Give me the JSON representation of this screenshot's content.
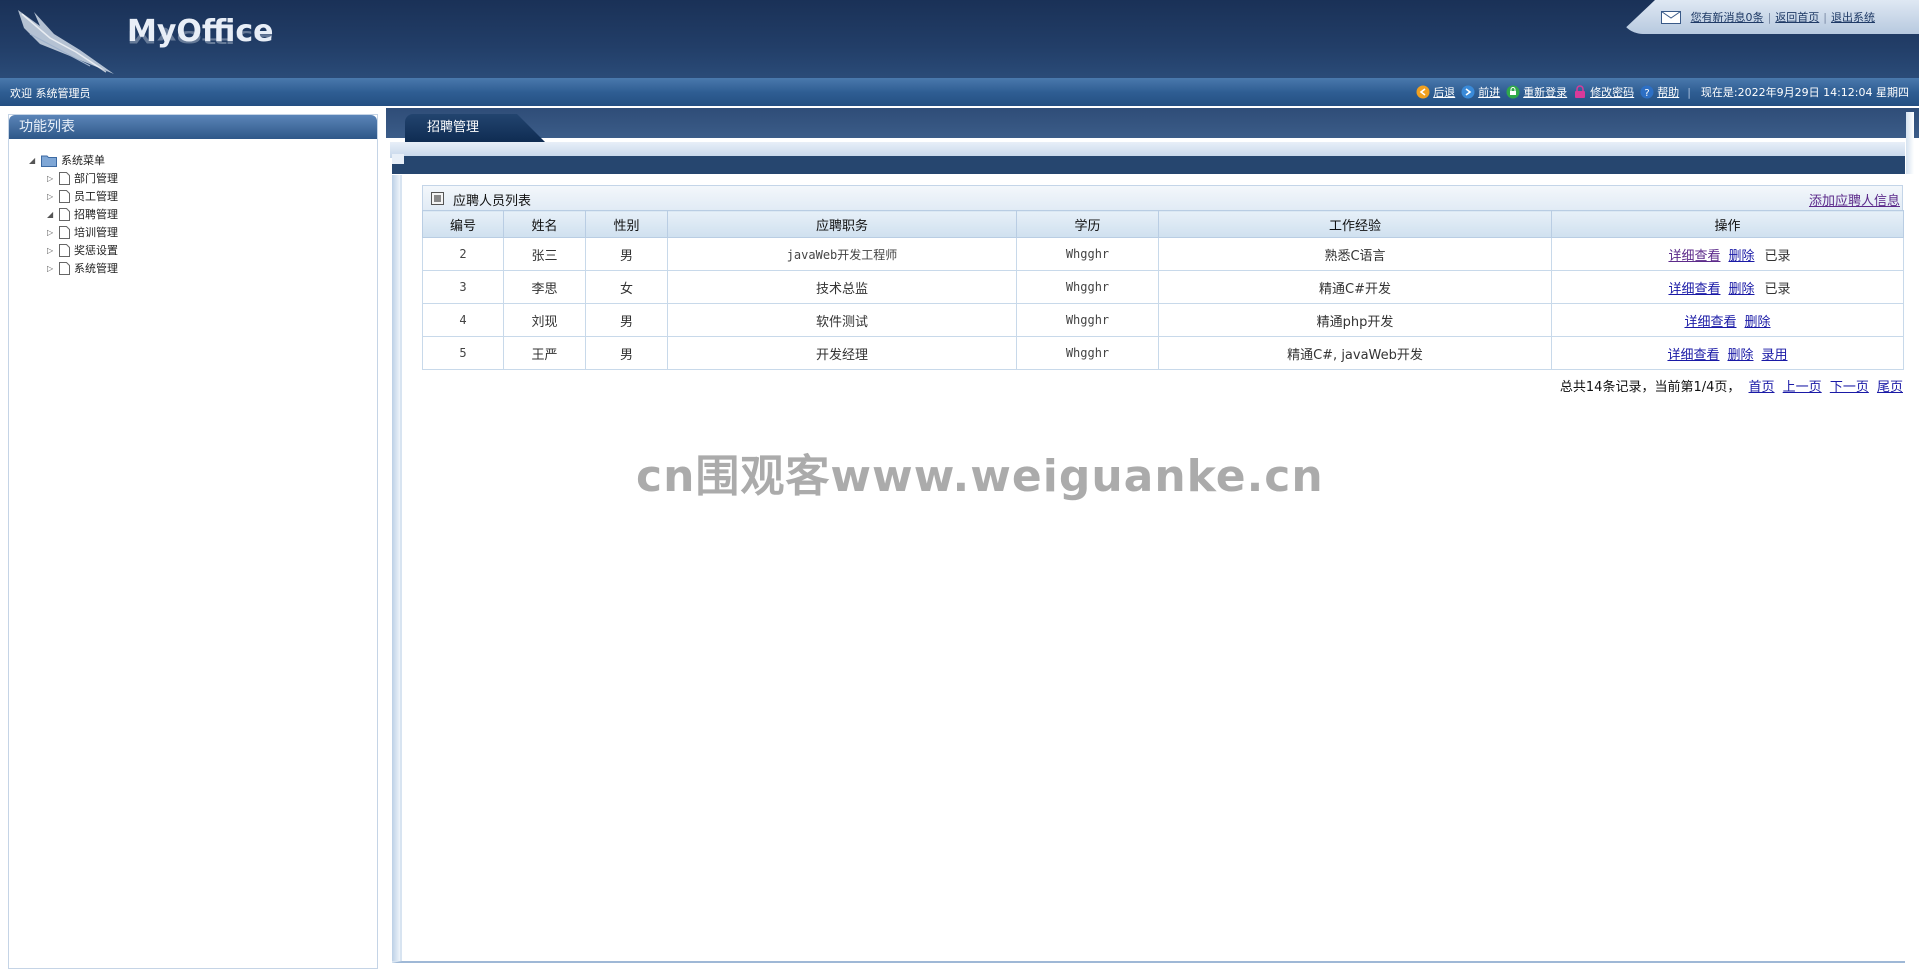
{
  "header": {
    "logo_text": "MyOffice",
    "message_link": "您有新消息0条",
    "home_link": "返回首页",
    "logout_link": "退出系统"
  },
  "bar": {
    "welcome": "欢迎 系统管理员",
    "actions": [
      "后退",
      "前进",
      "重新登录",
      "修改密码",
      "帮助"
    ],
    "clock": "现在是:2022年9月29日 14:12:04 星期四"
  },
  "sidebar": {
    "title": "功能列表",
    "root": "系统菜单",
    "items": [
      "部门管理",
      "员工管理",
      "招聘管理",
      "培训管理",
      "奖惩设置",
      "系统管理"
    ]
  },
  "tab": {
    "label": "招聘管理"
  },
  "list": {
    "title": "应聘人员列表",
    "add_link": "添加应聘人信息",
    "columns": [
      "编号",
      "姓名",
      "性别",
      "应聘职务",
      "学历",
      "工作经验",
      "操作"
    ],
    "rows": [
      {
        "id": "2",
        "name": "张三",
        "gender": "男",
        "position": "javaWeb开发工程师",
        "edu": "Whgghr",
        "exp": "熟悉C语言",
        "detail": "详细查看",
        "delete": "删除",
        "status": "已录"
      },
      {
        "id": "3",
        "name": "李思",
        "gender": "女",
        "position": "技术总监",
        "edu": "Whgghr",
        "exp": "精通C#开发",
        "detail": "详细查看",
        "delete": "删除",
        "status": "已录"
      },
      {
        "id": "4",
        "name": "刘现",
        "gender": "男",
        "position": "软件测试",
        "edu": "Whgghr",
        "exp": "精通php开发",
        "detail": "详细查看",
        "delete": "删除",
        "status": ""
      },
      {
        "id": "5",
        "name": "王严",
        "gender": "男",
        "position": "开发经理",
        "edu": "Whgghr",
        "exp": "精通C#, javaWeb开发",
        "detail": "详细查看",
        "delete": "删除",
        "status": "录用"
      }
    ]
  },
  "pager": {
    "summary": "总共14条记录，当前第1/4页，",
    "first": "首页",
    "prev": "上一页",
    "next": "下一页",
    "last": "尾页"
  },
  "watermark": "cn围观客www.weiguanke.cn"
}
